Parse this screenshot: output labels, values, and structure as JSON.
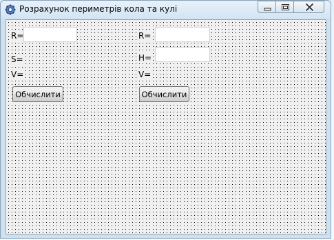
{
  "window": {
    "title": "Розрахунок периметрів кола та кулі",
    "controls": [
      "minimize-icon",
      "maximize-icon",
      "close-icon"
    ]
  },
  "form": {
    "left": {
      "r_label": "R=",
      "r_value": "",
      "s_label": "S=",
      "v_label": "V=",
      "button_label": "Обчислити"
    },
    "right": {
      "r_label": "R=",
      "r_value": "",
      "h_label": "H=",
      "h_value": "",
      "v_label": "V=",
      "button_label": "Обчислити"
    }
  }
}
